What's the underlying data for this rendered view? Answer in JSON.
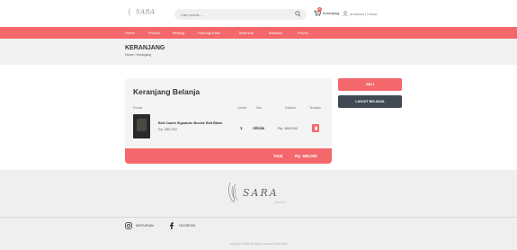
{
  "header": {
    "logo_text": "SARA",
    "search_placeholder": "Cari produk....",
    "cart_label": "Keranjang",
    "cart_count": "1",
    "auth_label": "andikasa | Keluar"
  },
  "nav": {
    "items": [
      "Home",
      "Produk",
      "Tentang",
      "Hubungi Kami",
      "Testimoni",
      "Bantuan",
      "Promo"
    ]
  },
  "breadcrumb": {
    "title": "KERANJANG",
    "path": "Home / Keranjang"
  },
  "cart": {
    "title": "Keranjang Belanja",
    "columns": {
      "product": "Produk",
      "qty": "Jumlah",
      "size": "Size",
      "subtotal": "Subtotal",
      "delete": "Tindakan"
    },
    "items": [
      {
        "name": "Belt Coach Signature Buckle Belt Black",
        "price": "Rp. 580,000",
        "qty": "1",
        "size": "Allsize",
        "subtotal": "Rp. 580.000",
        "delete_icon": "trash-icon"
      }
    ],
    "total_label": "Total",
    "total_value": "Rp. 580,000"
  },
  "actions": {
    "buy_label": "BELI",
    "continue_label": "LANJUT BELANJA"
  },
  "footer": {
    "logo_text": "SARA",
    "logo_sub": "WATCH",
    "instagram_label": "INSTAGRAM",
    "facebook_label": "FACEBOOK",
    "copyright": "Copyright ©2020 All rights reserved | Sara Store"
  },
  "colors": {
    "accent": "#f4686b",
    "dark_button": "#3f4a54",
    "band": "#f2f2f2"
  }
}
